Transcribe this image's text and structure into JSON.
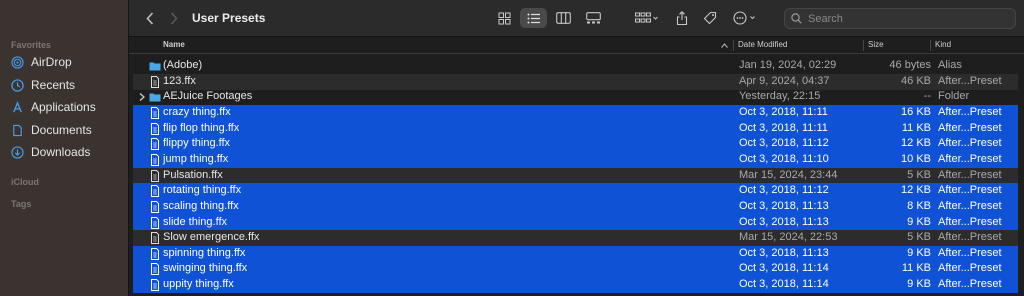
{
  "window": {
    "title": "User Presets"
  },
  "sidebar": {
    "favorites_label": "Favorites",
    "items": [
      {
        "label": "AirDrop",
        "icon": "airdrop-icon"
      },
      {
        "label": "Recents",
        "icon": "clock-icon"
      },
      {
        "label": "Applications",
        "icon": "applications-icon"
      },
      {
        "label": "Documents",
        "icon": "document-icon"
      },
      {
        "label": "Downloads",
        "icon": "download-icon"
      }
    ],
    "icloud_label": "iCloud",
    "tags_label": "Tags"
  },
  "toolbar": {
    "back_icon": "chevron-left-icon",
    "forward_icon": "chevron-right-icon",
    "view_modes": [
      "icon-view-icon",
      "list-view-icon",
      "column-view-icon",
      "gallery-view-icon"
    ],
    "active_view": "list",
    "search_placeholder": "Search"
  },
  "columns": {
    "name": "Name",
    "date": "Date Modified",
    "size": "Size",
    "kind": "Kind"
  },
  "colors": {
    "selection": "#0f52d6",
    "folder": "#4aa8e8"
  },
  "files": [
    {
      "name": "(Adobe)",
      "date": "Jan 19, 2024, 02:29",
      "size": "46 bytes",
      "kind": "Alias",
      "type": "folder",
      "selected": false
    },
    {
      "name": "123.ffx",
      "date": "Apr 9, 2024, 04:37",
      "size": "46 KB",
      "kind": "After...Preset",
      "type": "file",
      "selected": false
    },
    {
      "name": "AEJuice Footages",
      "date": "Yesterday, 22:15",
      "size": "--",
      "kind": "Folder",
      "type": "folder",
      "selected": false,
      "expandable": true
    },
    {
      "name": "crazy thing.ffx",
      "date": "Oct 3, 2018, 11:11",
      "size": "16 KB",
      "kind": "After...Preset",
      "type": "file",
      "selected": true
    },
    {
      "name": "flip flop thing.ffx",
      "date": "Oct 3, 2018, 11:11",
      "size": "11 KB",
      "kind": "After...Preset",
      "type": "file",
      "selected": true
    },
    {
      "name": "flippy thing.ffx",
      "date": "Oct 3, 2018, 11:12",
      "size": "12 KB",
      "kind": "After...Preset",
      "type": "file",
      "selected": true
    },
    {
      "name": "jump thing.ffx",
      "date": "Oct 3, 2018, 11:10",
      "size": "10 KB",
      "kind": "After...Preset",
      "type": "file",
      "selected": true
    },
    {
      "name": "Pulsation.ffx",
      "date": "Mar 15, 2024, 23:44",
      "size": "5 KB",
      "kind": "After...Preset",
      "type": "file",
      "selected": false
    },
    {
      "name": "rotating thing.ffx",
      "date": "Oct 3, 2018, 11:12",
      "size": "12 KB",
      "kind": "After...Preset",
      "type": "file",
      "selected": true
    },
    {
      "name": "scaling thing.ffx",
      "date": "Oct 3, 2018, 11:13",
      "size": "8 KB",
      "kind": "After...Preset",
      "type": "file",
      "selected": true
    },
    {
      "name": "slide thing.ffx",
      "date": "Oct 3, 2018, 11:13",
      "size": "9 KB",
      "kind": "After...Preset",
      "type": "file",
      "selected": true
    },
    {
      "name": "Slow emergence.ffx",
      "date": "Mar 15, 2024, 22:53",
      "size": "5 KB",
      "kind": "After...Preset",
      "type": "file",
      "selected": false
    },
    {
      "name": "spinning thing.ffx",
      "date": "Oct 3, 2018, 11:13",
      "size": "9 KB",
      "kind": "After...Preset",
      "type": "file",
      "selected": true
    },
    {
      "name": "swinging thing.ffx",
      "date": "Oct 3, 2018, 11:14",
      "size": "11 KB",
      "kind": "After...Preset",
      "type": "file",
      "selected": true
    },
    {
      "name": "uppity thing.ffx",
      "date": "Oct 3, 2018, 11:14",
      "size": "9 KB",
      "kind": "After...Preset",
      "type": "file",
      "selected": true
    }
  ]
}
